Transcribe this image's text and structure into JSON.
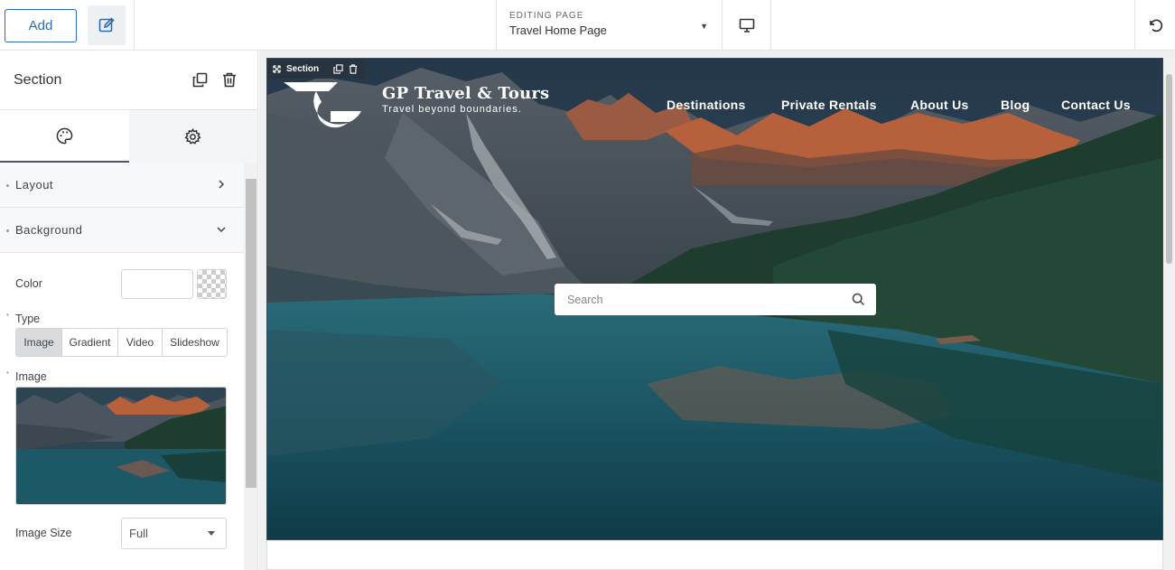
{
  "toolbar": {
    "add_label": "Add",
    "edit_icon": "edit-icon",
    "page_label": "EDITING PAGE",
    "page_value": "Travel Home Page",
    "device_icon": "desktop-icon",
    "undo_icon": "undo-icon"
  },
  "panel": {
    "title": "Section",
    "tabs": [
      "style",
      "settings"
    ],
    "sections": {
      "layout": "Layout",
      "background": "Background"
    },
    "background": {
      "color_label": "Color",
      "type_label": "Type",
      "types": [
        "Image",
        "Gradient",
        "Video",
        "Slideshow"
      ],
      "selected_type": "Image",
      "image_label": "Image",
      "image_size_label": "Image Size",
      "image_size_value": "Full"
    }
  },
  "canvas": {
    "section_tag": "Section",
    "brand_name": "GP Travel & Tours",
    "brand_tagline": "Travel beyond boundaries.",
    "nav": [
      "Destinations",
      "Private Rentals",
      "About Us",
      "Blog",
      "Contact Us"
    ],
    "search_placeholder": "Search"
  },
  "colors": {
    "accent": "#2b6cb0",
    "sky": "#2d4453",
    "lake": "#1d5866",
    "forest": "#1f3d2e",
    "peaks": "#b7603c"
  }
}
